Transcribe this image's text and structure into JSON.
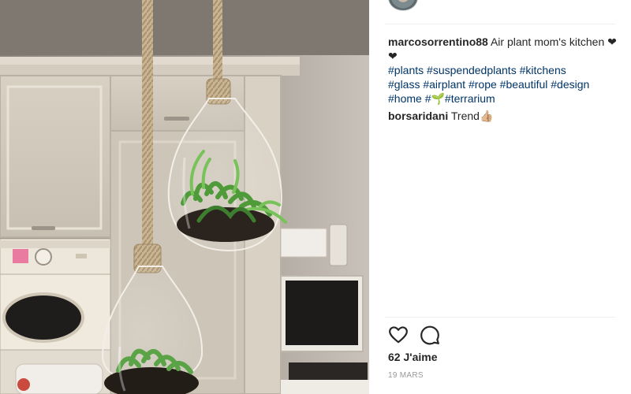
{
  "post": {
    "comments": [
      {
        "user": "marcosorrentino88",
        "text": " Air plant mom's kitchen ❤❤",
        "tag_lines": [
          [
            "#plants",
            "#suspendedplants",
            "#kitchens"
          ],
          [
            "#glass",
            "#airplant",
            "#rope",
            "#beautiful",
            "#design"
          ],
          [
            "#home",
            "#🌱#terrarium"
          ]
        ]
      },
      {
        "user": "borsaridani",
        "text": " Trend👍🏼"
      }
    ],
    "likes": "62 J'aime",
    "date": "19 MARS"
  },
  "icons": {
    "like": "heart-icon",
    "comment": "comment-bubble-icon"
  },
  "colors": {
    "hashtag": "#003569",
    "text": "#262626",
    "muted": "#999999",
    "divider": "#efefef"
  }
}
